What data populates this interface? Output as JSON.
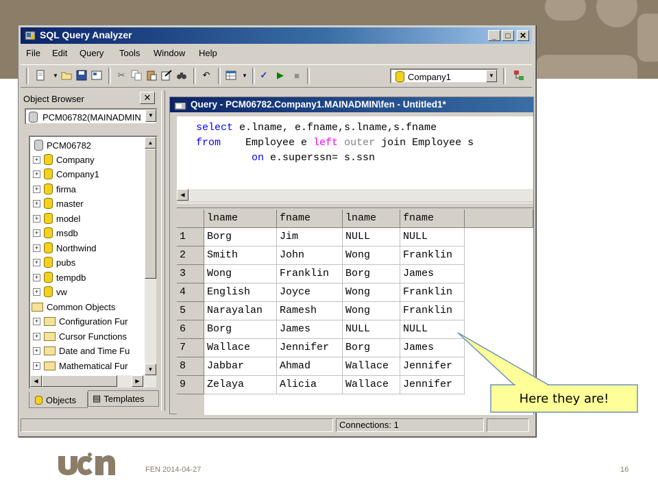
{
  "window": {
    "title": "SQL Query Analyzer",
    "minimize": "_",
    "maximize": "□",
    "close": "✕"
  },
  "menu": [
    "File",
    "Edit",
    "Query",
    "Tools",
    "Window",
    "Help"
  ],
  "toolbar": {
    "icons": [
      "new-query-icon",
      "open-icon",
      "save-icon",
      "insert-template-icon",
      "cut-icon",
      "copy-icon",
      "paste-icon",
      "clear-window-icon",
      "find-icon",
      "undo-icon",
      "results-mode-icon",
      "parse-icon",
      "execute-icon",
      "cancel-query-icon",
      "database-icon",
      "object-browser-icon"
    ],
    "database": "Company1"
  },
  "object_browser": {
    "title": "Object Browser",
    "close": "✕",
    "server": "PCM06782(MAINADMIN",
    "root": "PCM06782",
    "databases": [
      "Company",
      "Company1",
      "firma",
      "master",
      "model",
      "msdb",
      "Northwind",
      "pubs",
      "tempdb",
      "vw"
    ],
    "common_label": "Common Objects",
    "common_items": [
      "Configuration Fur",
      "Cursor Functions",
      "Date and Time Fu",
      "Mathematical Fur"
    ],
    "tabs": [
      "Objects",
      "Templates"
    ]
  },
  "query_window": {
    "title": "Query - PCM06782.Company1.MAINADMIN\\fen - Untitled1*",
    "code": {
      "l1_kw": "select",
      "l1_rest": " e.lname, e.fname,s.lname,s.fname",
      "l2_kw": "from",
      "l2_a": "    Employee e ",
      "l2_left": "left",
      "l2_outer": " outer ",
      "l2_b": "join Employee s",
      "l3_kw": "on",
      "l3_rest": " e.superssn= s.ssn"
    },
    "columns": [
      "lname",
      "fname",
      "lname",
      "fname"
    ],
    "rows": [
      [
        "1",
        "Borg",
        "Jim",
        "NULL",
        "NULL"
      ],
      [
        "2",
        "Smith",
        "John",
        "Wong",
        "Franklin"
      ],
      [
        "3",
        "Wong",
        "Franklin",
        "Borg",
        "James"
      ],
      [
        "4",
        "English",
        "Joyce",
        "Wong",
        "Franklin"
      ],
      [
        "5",
        "Narayalan",
        "Ramesh",
        "Wong",
        "Franklin"
      ],
      [
        "6",
        "Borg",
        "James",
        "NULL",
        "NULL"
      ],
      [
        "7",
        "Wallace",
        "Jennifer",
        "Borg",
        "James"
      ],
      [
        "8",
        "Jabbar",
        "Ahmad",
        "Wallace",
        "Jennifer"
      ],
      [
        "9",
        "Zelaya",
        "Alicia",
        "Wallace",
        "Jennifer"
      ]
    ]
  },
  "status": {
    "connections": "Connections: 1"
  },
  "callout": "Here they are!",
  "footer": {
    "date": "FEN 2014-04-27",
    "page": "16",
    "logo": "ucn"
  },
  "colors": {
    "band": "#8b7d68",
    "callout_fill": "#ffff99",
    "keyword": "#0000ff",
    "left_keyword": "#ff00ff"
  }
}
